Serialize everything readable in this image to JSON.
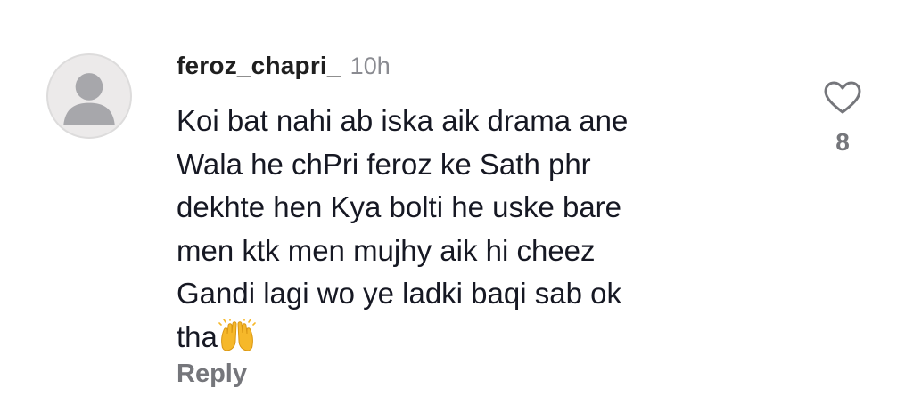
{
  "comment": {
    "username": "feroz_chapri_",
    "timestamp": "10h",
    "text_lines": [
      "Koi bat nahi ab iska aik drama ane",
      "Wala he chPri feroz ke Sath phr",
      "dekhte hen Kya bolti he uske bare",
      "men ktk men mujhy aik hi cheez",
      "Gandi lagi wo ye ladki baqi sab ok",
      "tha"
    ],
    "emoji": "raising-hands-emoji",
    "reply_label": "Reply",
    "like_count": "8"
  },
  "icons": {
    "avatar": "default-avatar-icon",
    "like": "heart-outline-icon"
  },
  "colors": {
    "text": "#161823",
    "muted": "#75767b",
    "timestamp": "#8a8b91",
    "avatar_bg": "#eceaea",
    "avatar_figure": "#a7a7ab",
    "emoji": "#f6b82a"
  }
}
